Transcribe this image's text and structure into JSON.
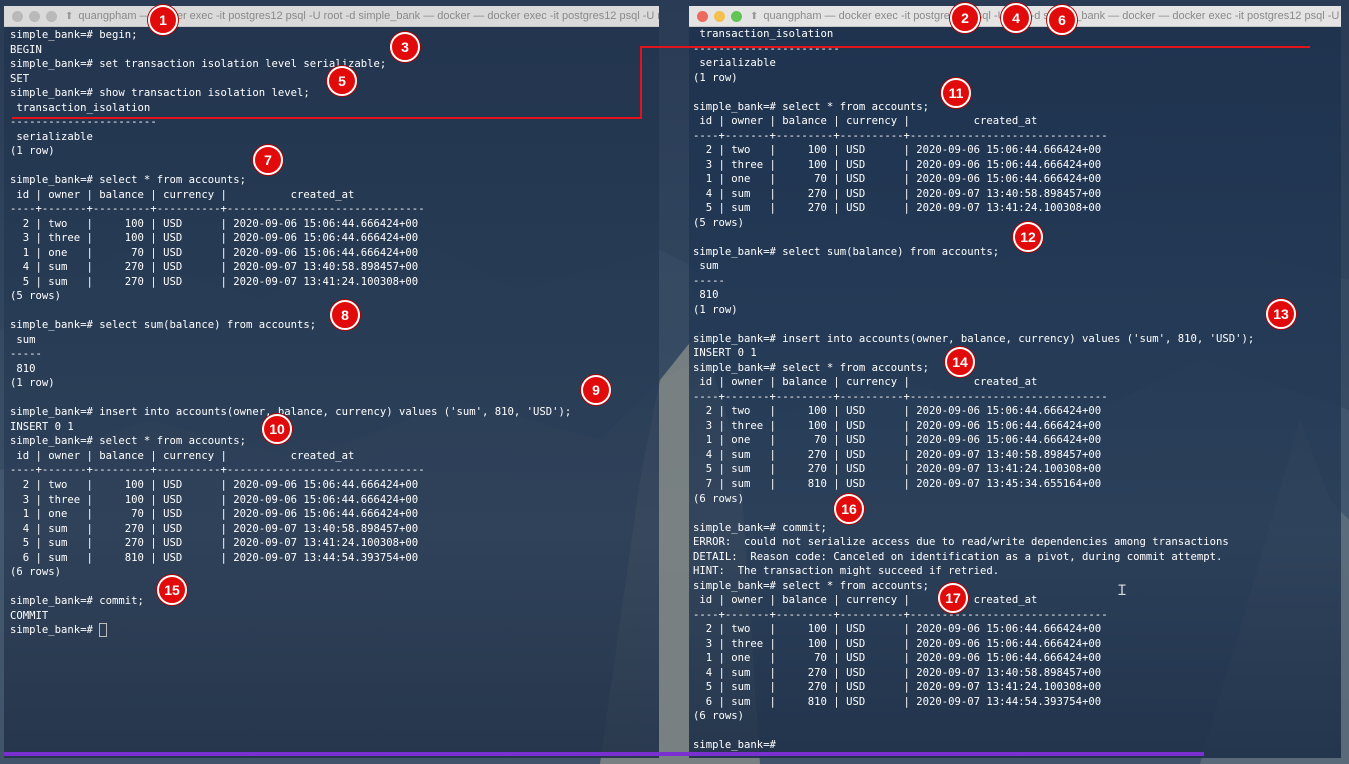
{
  "left_window": {
    "title": "quangpham — docker exec -it postgres12 psql -U root -d simple_bank — docker — docker exec -it postgres12 psql -U r...",
    "lines": [
      "simple_bank=# begin;",
      "BEGIN",
      "simple_bank=# set transaction isolation level serializable;",
      "SET",
      "simple_bank=# show transaction isolation level;",
      " transaction_isolation",
      "-----------------------",
      " serializable",
      "(1 row)",
      "",
      "simple_bank=# select * from accounts;",
      " id | owner | balance | currency |          created_at",
      "----+-------+---------+----------+-------------------------------",
      "  2 | two   |     100 | USD      | 2020-09-06 15:06:44.666424+00",
      "  3 | three |     100 | USD      | 2020-09-06 15:06:44.666424+00",
      "  1 | one   |      70 | USD      | 2020-09-06 15:06:44.666424+00",
      "  4 | sum   |     270 | USD      | 2020-09-07 13:40:58.898457+00",
      "  5 | sum   |     270 | USD      | 2020-09-07 13:41:24.100308+00",
      "(5 rows)",
      "",
      "simple_bank=# select sum(balance) from accounts;",
      " sum",
      "-----",
      " 810",
      "(1 row)",
      "",
      "simple_bank=# insert into accounts(owner, balance, currency) values ('sum', 810, 'USD');",
      "INSERT 0 1",
      "simple_bank=# select * from accounts;",
      " id | owner | balance | currency |          created_at",
      "----+-------+---------+----------+-------------------------------",
      "  2 | two   |     100 | USD      | 2020-09-06 15:06:44.666424+00",
      "  3 | three |     100 | USD      | 2020-09-06 15:06:44.666424+00",
      "  1 | one   |      70 | USD      | 2020-09-06 15:06:44.666424+00",
      "  4 | sum   |     270 | USD      | 2020-09-07 13:40:58.898457+00",
      "  5 | sum   |     270 | USD      | 2020-09-07 13:41:24.100308+00",
      "  6 | sum   |     810 | USD      | 2020-09-07 13:44:54.393754+00",
      "(6 rows)",
      "",
      "simple_bank=# commit;",
      "COMMIT"
    ],
    "prompt": "simple_bank=# "
  },
  "right_window": {
    "title": "quangpham — docker exec -it postgres12 psql -U root -d simple_bank — docker — docker exec -it postgres12 psql -U r...",
    "lines": [
      " transaction_isolation",
      "-----------------------",
      " serializable",
      "(1 row)",
      "",
      "simple_bank=# select * from accounts;",
      " id | owner | balance | currency |          created_at",
      "----+-------+---------+----------+-------------------------------",
      "  2 | two   |     100 | USD      | 2020-09-06 15:06:44.666424+00",
      "  3 | three |     100 | USD      | 2020-09-06 15:06:44.666424+00",
      "  1 | one   |      70 | USD      | 2020-09-06 15:06:44.666424+00",
      "  4 | sum   |     270 | USD      | 2020-09-07 13:40:58.898457+00",
      "  5 | sum   |     270 | USD      | 2020-09-07 13:41:24.100308+00",
      "(5 rows)",
      "",
      "simple_bank=# select sum(balance) from accounts;",
      " sum",
      "-----",
      " 810",
      "(1 row)",
      "",
      "simple_bank=# insert into accounts(owner, balance, currency) values ('sum', 810, 'USD');",
      "INSERT 0 1",
      "simple_bank=# select * from accounts;",
      " id | owner | balance | currency |          created_at",
      "----+-------+---------+----------+-------------------------------",
      "  2 | two   |     100 | USD      | 2020-09-06 15:06:44.666424+00",
      "  3 | three |     100 | USD      | 2020-09-06 15:06:44.666424+00",
      "  1 | one   |      70 | USD      | 2020-09-06 15:06:44.666424+00",
      "  4 | sum   |     270 | USD      | 2020-09-07 13:40:58.898457+00",
      "  5 | sum   |     270 | USD      | 2020-09-07 13:41:24.100308+00",
      "  7 | sum   |     810 | USD      | 2020-09-07 13:45:34.655164+00",
      "(6 rows)",
      "",
      "simple_bank=# commit;",
      "ERROR:  could not serialize access due to read/write dependencies among transactions",
      "DETAIL:  Reason code: Canceled on identification as a pivot, during commit attempt.",
      "HINT:  The transaction might succeed if retried.",
      "simple_bank=# select * from accounts;",
      " id | owner | balance | currency |          created_at",
      "----+-------+---------+----------+-------------------------------",
      "  2 | two   |     100 | USD      | 2020-09-06 15:06:44.666424+00",
      "  3 | three |     100 | USD      | 2020-09-06 15:06:44.666424+00",
      "  1 | one   |      70 | USD      | 2020-09-06 15:06:44.666424+00",
      "  4 | sum   |     270 | USD      | 2020-09-07 13:40:58.898457+00",
      "  5 | sum   |     270 | USD      | 2020-09-07 13:41:24.100308+00",
      "  6 | sum   |     810 | USD      | 2020-09-07 13:44:54.393754+00",
      "(6 rows)",
      "",
      "simple_bank=#"
    ]
  },
  "step_badges": [
    "1",
    "2",
    "3",
    "4",
    "5",
    "6",
    "7",
    "8",
    "9",
    "10",
    "11",
    "12",
    "13",
    "14",
    "15",
    "16",
    "17"
  ],
  "colors": {
    "badge": "#e20b0b",
    "annotation_line": "#e3131b",
    "terminal_text": "#ffffff",
    "progress_bar": "#7a2fd0"
  }
}
